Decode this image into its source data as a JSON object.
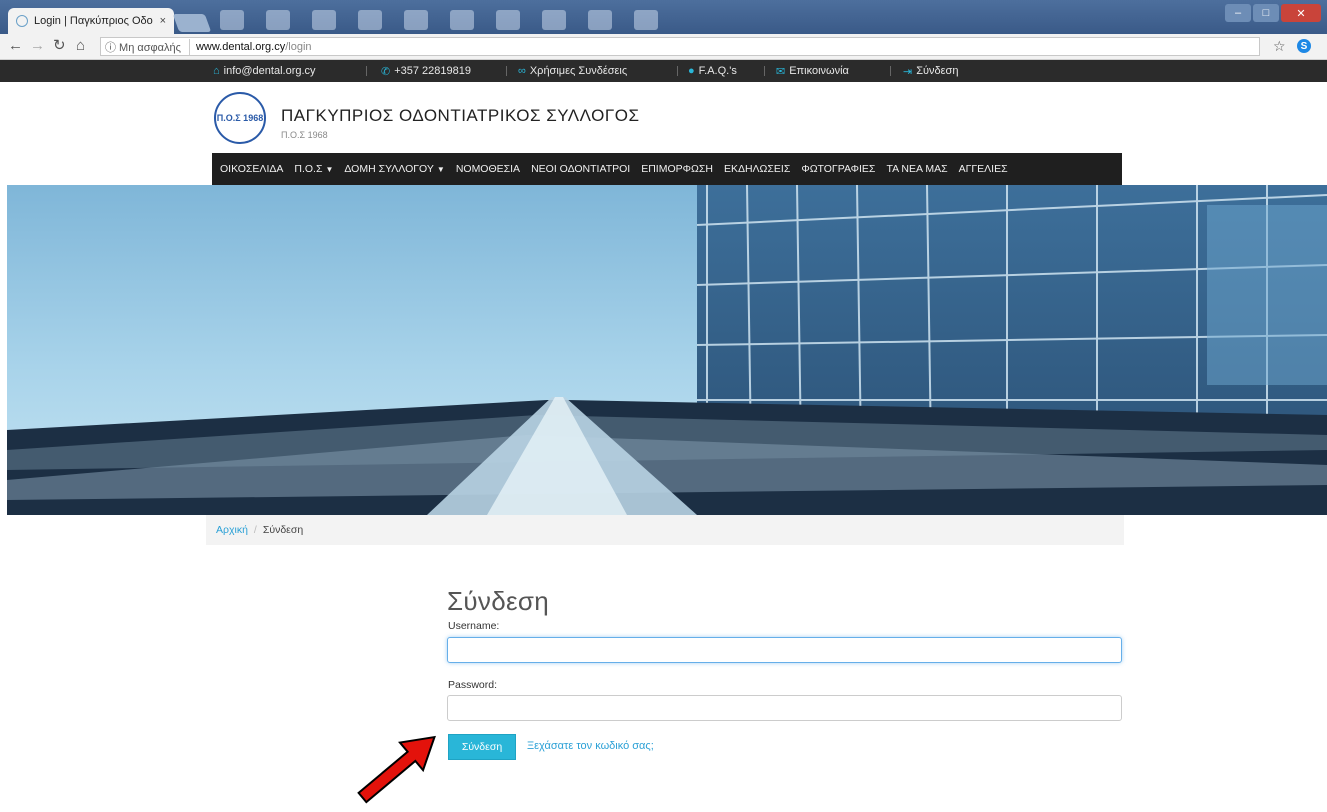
{
  "browser": {
    "tab_title": "Login | Παγκύπριος Οδο",
    "tab_close": "×",
    "security_label": "ⓘ Μη ασφαλής",
    "url_host": "www.dental.org.cy",
    "url_path": "/login"
  },
  "infobar": {
    "email": "info@dental.org.cy",
    "phone": "+357 22819819",
    "links": "Χρήσιμες Συνδέσεις",
    "faq": "F.A.Q.'s",
    "contact": "Επικοινωνία",
    "login": "Σύνδεση"
  },
  "header": {
    "title": "ΠΑΓΚΥΠΡΙΟΣ ΟΔΟΝΤΙΑΤΡΙΚΟΣ ΣΥΛΛΟΓΟΣ",
    "subtitle": "Π.Ο.Σ 1968",
    "logo_text": "Π.Ο.Σ 1968"
  },
  "nav": {
    "items": [
      {
        "label": "ΟΙΚΟΣΕΛΙΔΑ",
        "dropdown": false
      },
      {
        "label": "Π.Ο.Σ",
        "dropdown": true
      },
      {
        "label": "ΔΟΜΗ ΣΥΛΛΟΓΟΥ",
        "dropdown": true
      },
      {
        "label": "ΝΟΜΟΘΕΣΙΑ",
        "dropdown": false
      },
      {
        "label": "ΝΕΟΙ ΟΔΟΝΤΙΑΤΡΟΙ",
        "dropdown": false
      },
      {
        "label": "ΕΠΙΜΟΡΦΩΣΗ",
        "dropdown": false
      },
      {
        "label": "ΕΚΔΗΛΩΣΕΙΣ",
        "dropdown": false
      },
      {
        "label": "ΦΩΤΟΓΡΑΦΙΕΣ",
        "dropdown": false
      },
      {
        "label": "ΤΑ ΝΕΑ ΜΑΣ",
        "dropdown": false
      },
      {
        "label": "ΑΓΓΕΛΙΕΣ",
        "dropdown": false
      }
    ]
  },
  "breadcrumb": {
    "home": "Αρχική",
    "separator": "/",
    "current": "Σύνδεση"
  },
  "login": {
    "title": "Σύνδεση",
    "username_label": "Username:",
    "username_value": "",
    "password_label": "Password:",
    "password_value": "",
    "submit_label": "Σύνδεση",
    "forgot_label": "Ξεχάσατε τον κωδικό σας;"
  },
  "colors": {
    "accent": "#29b6d8",
    "link": "#2aa0d6",
    "nav_bg": "#1f1f1f",
    "annotation": "#e3120b"
  }
}
